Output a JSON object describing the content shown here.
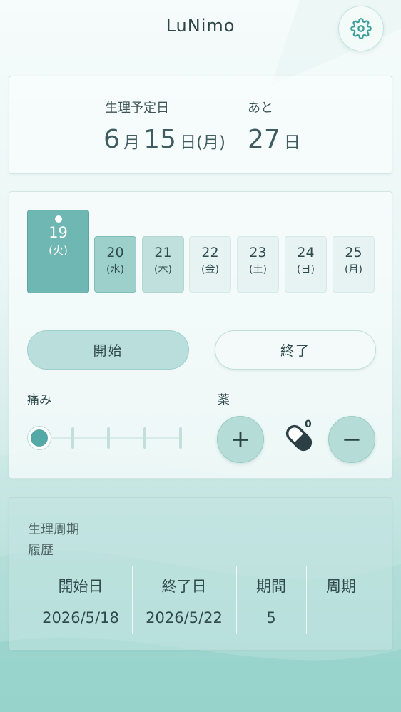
{
  "app": {
    "title": "LuNimo"
  },
  "next_period": {
    "label": "生理予定日",
    "month": "6",
    "month_unit": "月",
    "day": "15",
    "day_unit": "日",
    "weekday": "(月)",
    "remaining_label": "あと",
    "remaining_days": "27",
    "remaining_unit": "日"
  },
  "calendar": {
    "days": [
      {
        "num": "19",
        "weekday": "(火)"
      },
      {
        "num": "20",
        "weekday": "(水)"
      },
      {
        "num": "21",
        "weekday": "(木)"
      },
      {
        "num": "22",
        "weekday": "(金)"
      },
      {
        "num": "23",
        "weekday": "(土)"
      },
      {
        "num": "24",
        "weekday": "(日)"
      },
      {
        "num": "25",
        "weekday": "(月)"
      }
    ]
  },
  "actions": {
    "start_label": "開始",
    "end_label": "終了"
  },
  "pain": {
    "label": "痛み",
    "level": 0,
    "max_level": 4
  },
  "medicine": {
    "label": "薬",
    "count": "0",
    "plus": "+",
    "minus": "−"
  },
  "history": {
    "title_line1": "生理周期",
    "title_line2": "履歴",
    "headers": [
      "開始日",
      "終了日",
      "期間",
      "周期"
    ],
    "rows": [
      [
        "2026/5/18",
        "2026/5/22",
        "5",
        ""
      ]
    ]
  },
  "colors": {
    "accent": "#6fb7b3",
    "knob": "#54a8a6",
    "text": "#2f4a4c"
  },
  "icons": {
    "settings": "gear-icon",
    "medicine": "pill-icon"
  }
}
